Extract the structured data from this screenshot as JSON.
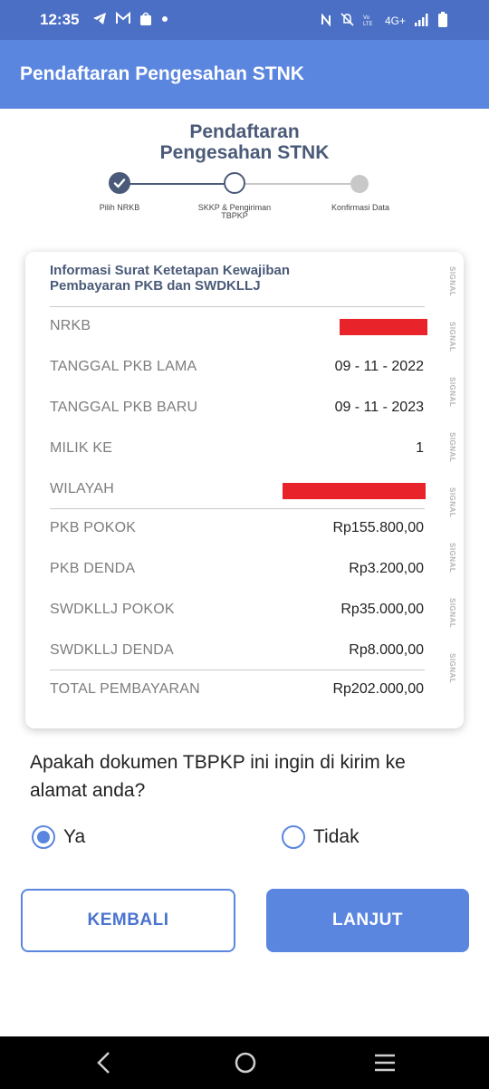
{
  "status_bar": {
    "time": "12:35",
    "left_icons": [
      "telegram-icon",
      "gmail-icon",
      "shop-icon",
      "dot-icon"
    ],
    "right_icons": [
      "nfc-icon",
      "mute-icon",
      "volte-icon",
      "network-4g-icon",
      "signal-icon",
      "battery-icon"
    ],
    "network_label": "4G+"
  },
  "app_bar": {
    "title": "Pendaftaran Pengesahan STNK"
  },
  "page": {
    "title_line1": "Pendaftaran",
    "title_line2": "Pengesahan STNK"
  },
  "stepper": {
    "steps": [
      {
        "label": "Pilih NRKB",
        "state": "completed"
      },
      {
        "label_line1": "SKKP & Pengiriman",
        "label_line2": "TBPKP",
        "state": "current"
      },
      {
        "label": "Konfirmasi Data",
        "state": "pending"
      }
    ]
  },
  "card": {
    "heading_line1": "Informasi Surat Ketetapan Kewajiban",
    "heading_line2": "Pembayaran PKB dan SWDKLLJ",
    "watermark": "SIGNAL",
    "rows": [
      {
        "label": "NRKB",
        "value": "",
        "redacted": true
      },
      {
        "label": "TANGGAL PKB LAMA",
        "value": "09 - 11 - 2022"
      },
      {
        "label": "TANGGAL PKB BARU",
        "value": "09 - 11 - 2023"
      },
      {
        "label": "MILIK KE",
        "value": "1"
      },
      {
        "label": "WILAYAH",
        "value": "",
        "redacted": true
      },
      {
        "label": "PKB POKOK",
        "value": "Rp155.800,00"
      },
      {
        "label": "PKB DENDA",
        "value": "Rp3.200,00"
      },
      {
        "label": "SWDKLLJ POKOK",
        "value": "Rp35.000,00"
      },
      {
        "label": "SWDKLLJ DENDA",
        "value": "Rp8.000,00"
      },
      {
        "label": "TOTAL PEMBAYARAN",
        "value": "Rp202.000,00"
      }
    ]
  },
  "question": {
    "text": "Apakah dokumen TBPKP ini ingin di kirim ke alamat anda?"
  },
  "options": {
    "yes": "Ya",
    "no": "Tidak",
    "selected": "Ya"
  },
  "buttons": {
    "back": "KEMBALI",
    "next": "LANJUT"
  },
  "colors": {
    "primary": "#5b86e0",
    "status_bar": "#4a6fc4",
    "heading": "#4a5a78",
    "redaction": "#e8242a"
  }
}
